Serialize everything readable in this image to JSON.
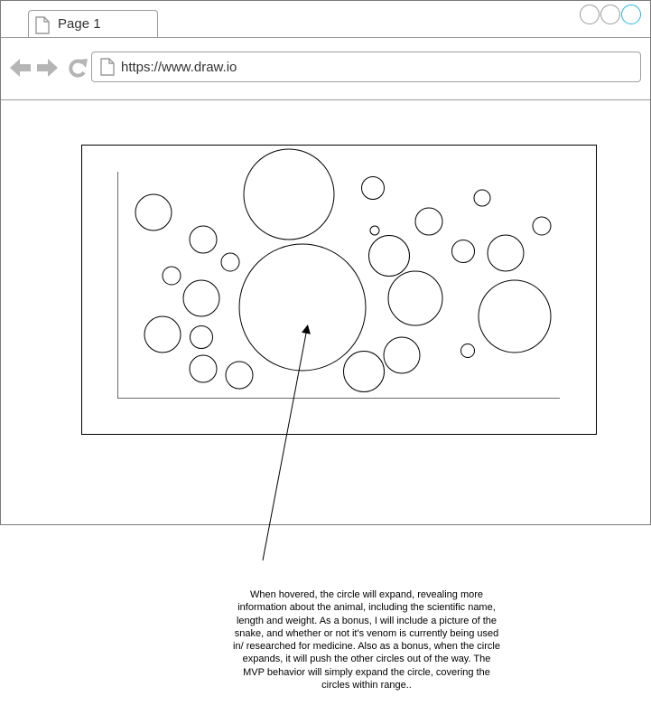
{
  "browser": {
    "tab_label": "Page 1",
    "url": "https://www.draw.io",
    "icons": [
      "page-icon",
      "back-arrow-icon",
      "forward-arrow-icon",
      "refresh-icon",
      "window-control-icons"
    ]
  },
  "annotation": {
    "text": "When hovered, the circle will expand, revealing more\ninformation about the animal, including the scientific name,\nlength and weight. As a bonus, I will include a picture of the\nsnake, and whether or not it's venom is currently being used\nin/ researched for medicine. Also as a bonus, when the circle\nexpands, it will push the other circles out of the way. The\nMVP behavior will simply expand the circle, covering the\ncircles within range.."
  },
  "colors": {
    "chrome_border": "#9a9a9a",
    "icon_gray": "#b5b5b5",
    "active_window_button": "#27b5e0",
    "line": "#000000"
  }
}
